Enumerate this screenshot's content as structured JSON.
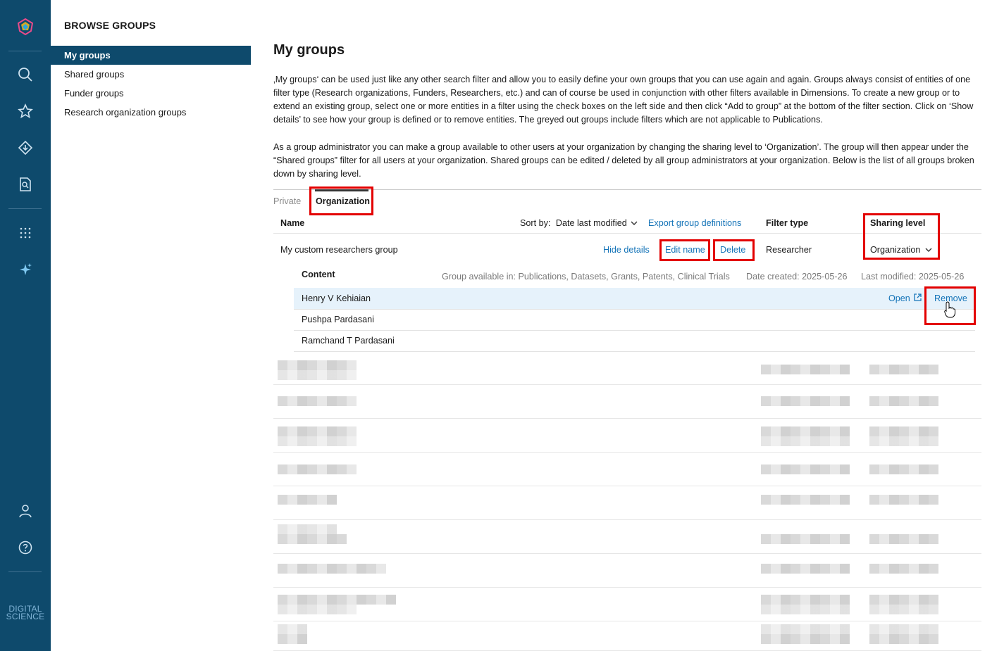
{
  "rail": {
    "brand_line1": "DIGITAL",
    "brand_line2": "SCIENCE",
    "icons": [
      "logo-icon",
      "search-icon",
      "star-icon",
      "diamond-arrow-icon",
      "document-search-icon",
      "grid-dots-icon",
      "sparkle-icon",
      "user-icon",
      "help-icon"
    ]
  },
  "browse": {
    "title": "BROWSE GROUPS",
    "items": [
      {
        "label": "My groups",
        "active": true
      },
      {
        "label": "Shared groups"
      },
      {
        "label": "Funder groups"
      },
      {
        "label": "Research organization groups"
      }
    ]
  },
  "main": {
    "title": "My groups",
    "intro": "‚My groups‘ can be used just like any other search filter and allow you to easily define your own groups that you can use again and again. Groups always consist of entities of one filter type (Research organizations, Funders, Researchers, etc.) and can of course be used in conjunction with other filters available in Dimensions. To create a new group or to extend an existing group, select one or more entities in a filter using the check boxes on the left side and then click “Add to group” at the bottom of the filter section. Click on ‘Show details’ to see how your group is defined or to remove entities. The greyed out groups include filters which are not applicable to Publications.",
    "admin_note": "As a group administrator you can make a group available to other users at your organization by changing the sharing level to ‘Organization’. The group will then appear under the “Shared groups” filter for all users at your organization. Shared groups can be edited / deleted by all group administrators at your organization. Below is the list of all groups broken down by sharing level.",
    "tabs": {
      "private": "Private",
      "organization": "Organization"
    },
    "table": {
      "col_name": "Name",
      "sort_by_label": "Sort by:",
      "sort_by_value": "Date last modified",
      "export_link": "Export group definitions",
      "col_filter_type": "Filter type",
      "col_sharing": "Sharing level"
    },
    "group": {
      "name": "My custom researchers group",
      "hide_details": "Hide details",
      "edit_name": "Edit name",
      "delete": "Delete",
      "filter_type": "Researcher",
      "sharing_level": "Organization",
      "content_label": "Content",
      "available_in": "Group available in: Publications, Datasets, Grants, Patents, Clinical Trials",
      "date_created": "Date created: 2025-05-26",
      "last_modified": "Last modified: 2025-05-26",
      "open_label": "Open",
      "remove_label": "Remove",
      "members": [
        "Henry V Kehiaian",
        "Pushpa Pardasani",
        "Ramchand T Pardasani"
      ]
    }
  },
  "colors": {
    "rail": "#0e4a6c",
    "link": "#1574b8",
    "highlight": "#e30000",
    "row_hover": "#e6f2fb"
  }
}
